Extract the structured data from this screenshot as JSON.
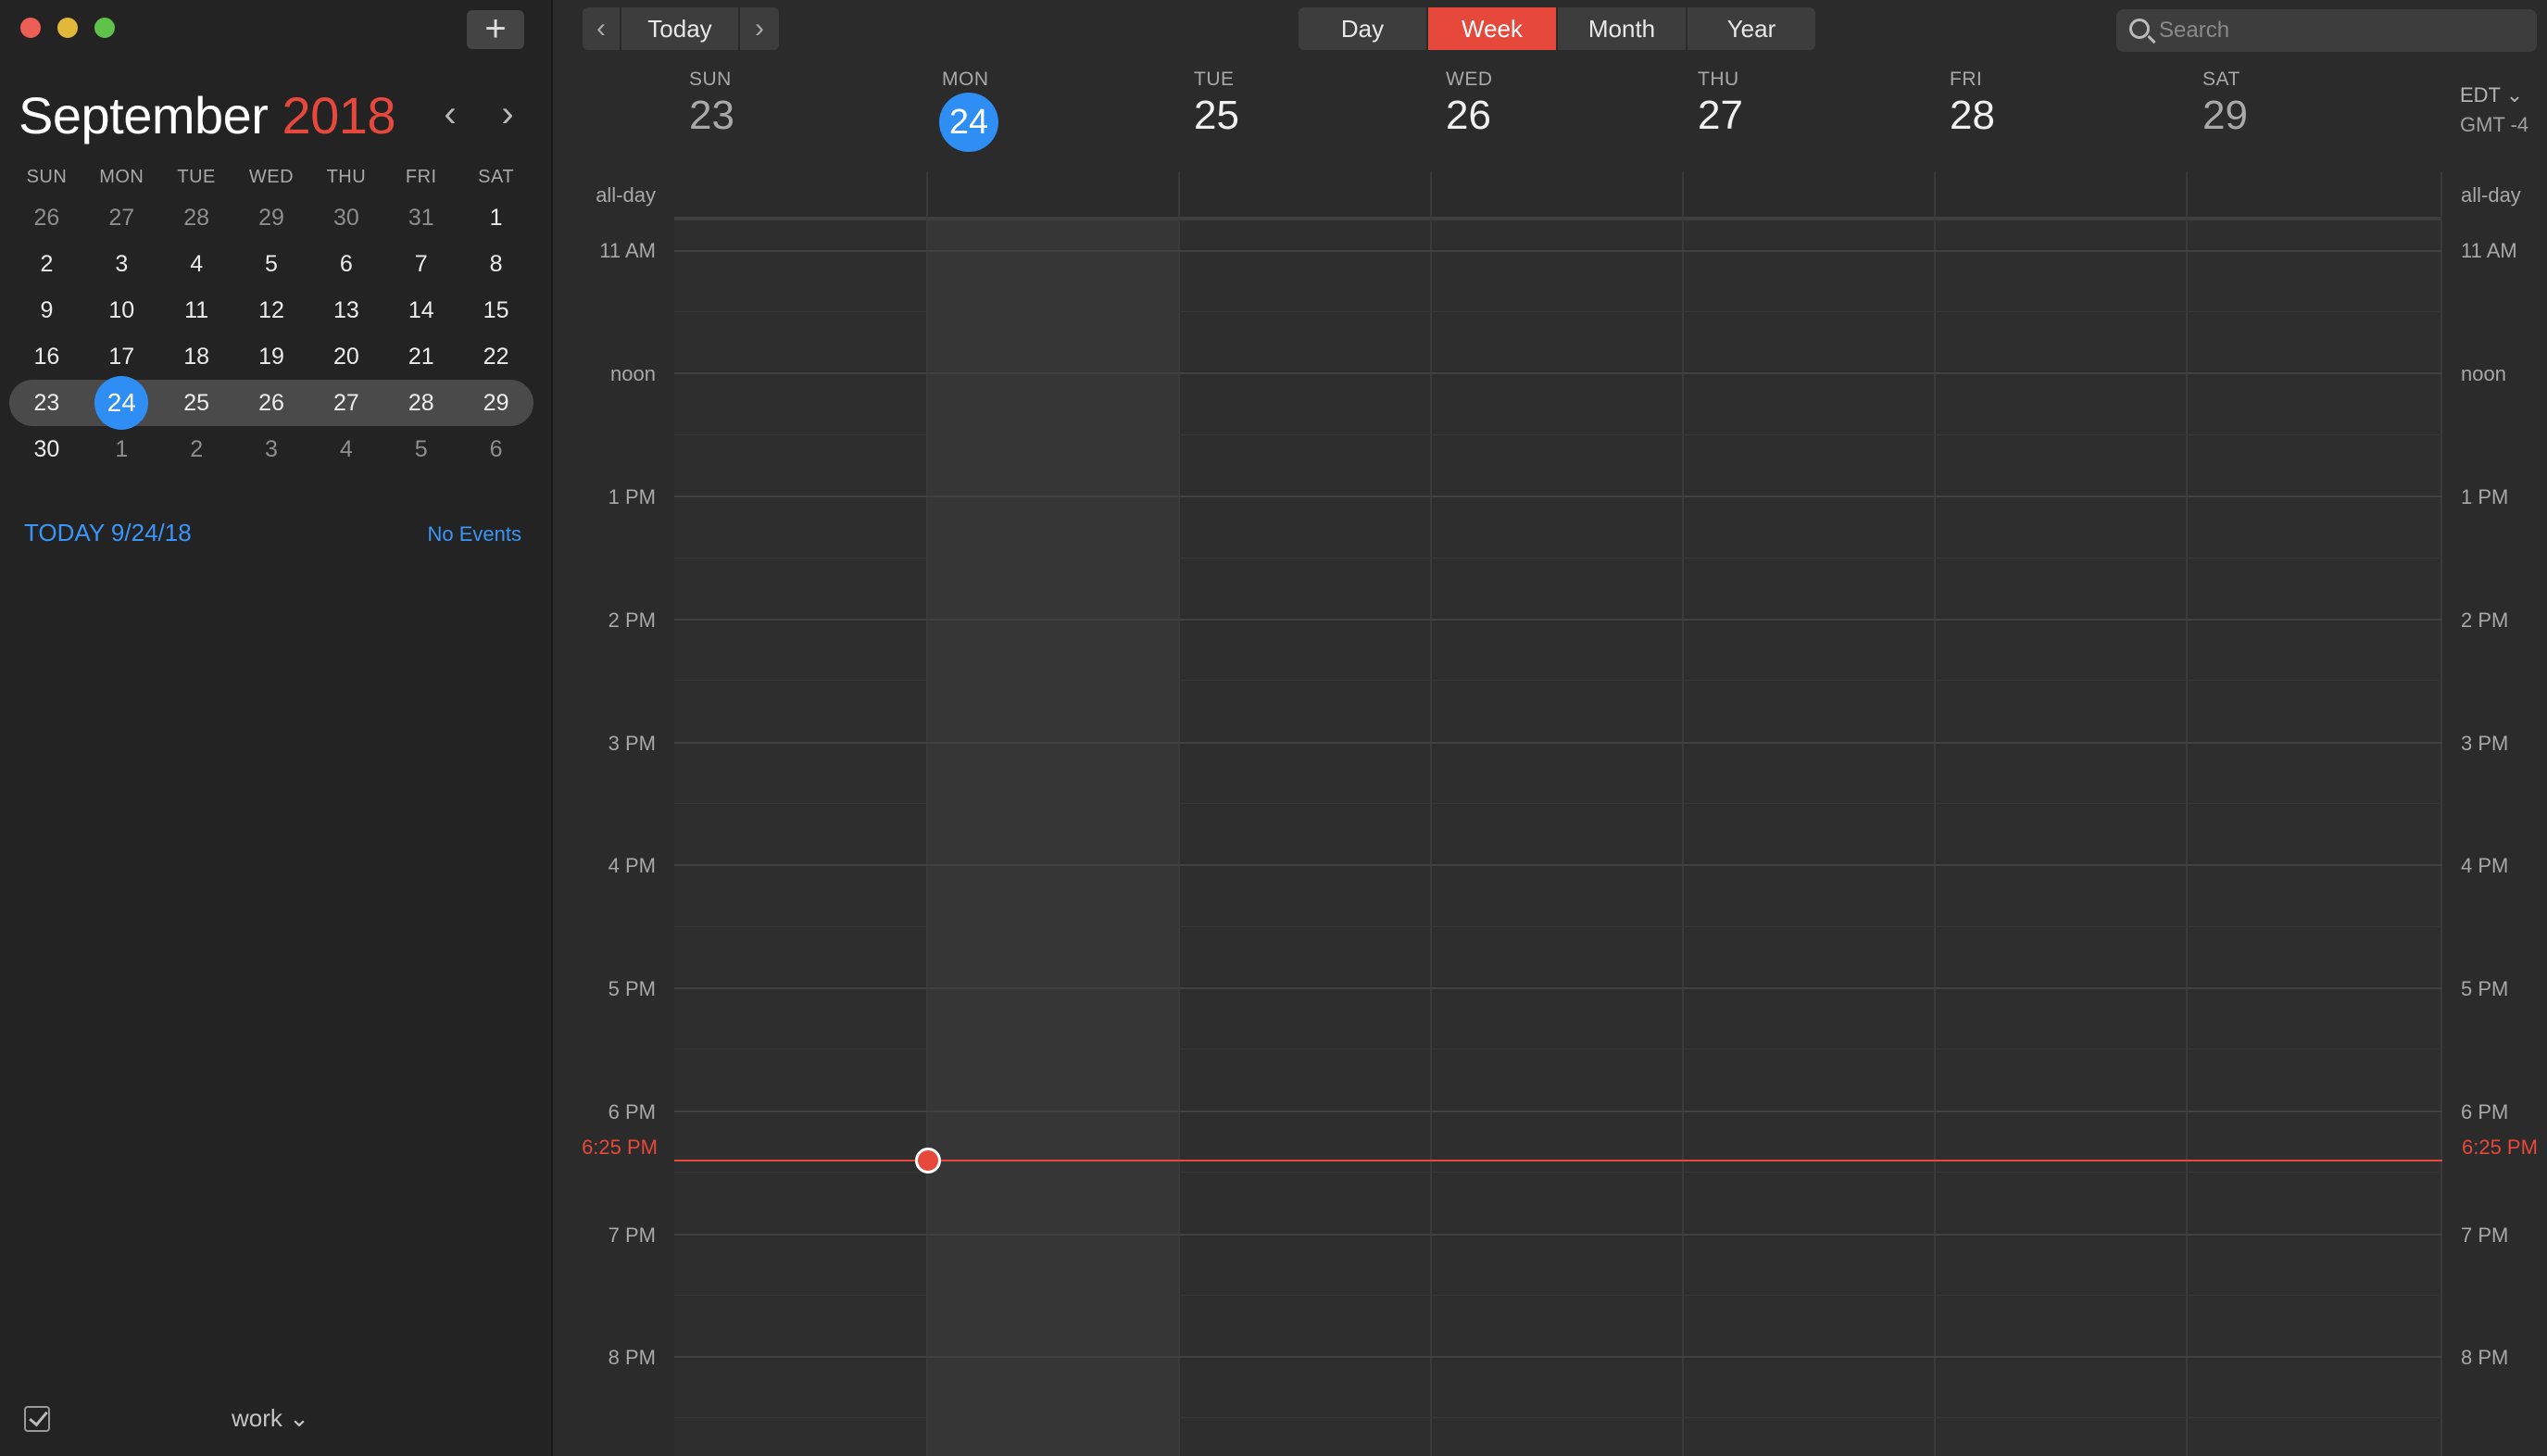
{
  "window": {
    "controls": {
      "close_color": "#ed5e57",
      "minimize_color": "#e2b83b",
      "zoom_color": "#5fc24b"
    },
    "add_label": "+"
  },
  "mini_calendar": {
    "month": "September",
    "year": "2018",
    "prev_label": "‹",
    "next_label": "›",
    "dow": [
      "SUN",
      "MON",
      "TUE",
      "WED",
      "THU",
      "FRI",
      "SAT"
    ],
    "weeks": [
      [
        "26",
        "27",
        "28",
        "29",
        "30",
        "31",
        "1"
      ],
      [
        "2",
        "3",
        "4",
        "5",
        "6",
        "7",
        "8"
      ],
      [
        "9",
        "10",
        "11",
        "12",
        "13",
        "14",
        "15"
      ],
      [
        "16",
        "17",
        "18",
        "19",
        "20",
        "21",
        "22"
      ],
      [
        "23",
        "24",
        "25",
        "26",
        "27",
        "28",
        "29"
      ],
      [
        "30",
        "1",
        "2",
        "3",
        "4",
        "5",
        "6"
      ]
    ],
    "today_label": "TODAY 9/24/18",
    "events_label": "No Events"
  },
  "footer": {
    "calendar_name": "work ⌄"
  },
  "toolbar": {
    "prev": "‹",
    "today": "Today",
    "next": "›",
    "views": [
      "Day",
      "Week",
      "Month",
      "Year"
    ],
    "active_view": "Week",
    "search_placeholder": "Search"
  },
  "week": {
    "days": [
      {
        "dow": "SUN",
        "num": "23"
      },
      {
        "dow": "MON",
        "num": "24"
      },
      {
        "dow": "TUE",
        "num": "25"
      },
      {
        "dow": "WED",
        "num": "26"
      },
      {
        "dow": "THU",
        "num": "27"
      },
      {
        "dow": "FRI",
        "num": "28"
      },
      {
        "dow": "SAT",
        "num": "29"
      }
    ],
    "timezone": "EDT ⌄",
    "gmt": "GMT -4",
    "allday_label": "all-day",
    "hours": [
      "11 AM",
      "noon",
      "1 PM",
      "2 PM",
      "3 PM",
      "4 PM",
      "5 PM",
      "6 PM",
      "7 PM",
      "8 PM"
    ],
    "now_label": "6:25 PM"
  },
  "colors": {
    "accent_red": "#e6493c",
    "today_blue": "#2f8ef4",
    "link_blue": "#3b95f7"
  }
}
